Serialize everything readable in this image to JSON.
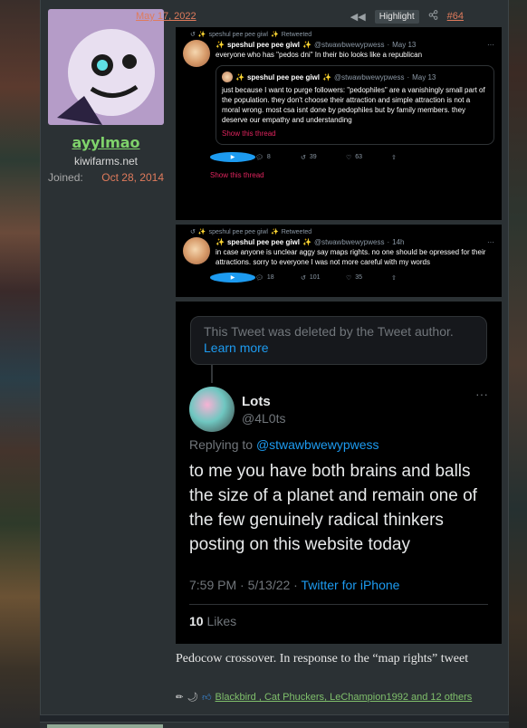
{
  "user": {
    "name": "ayylmao",
    "title": "kiwifarms.net",
    "joined_label": "Joined:",
    "joined_date": "Oct 28, 2014"
  },
  "post": {
    "date": "May 17, 2022",
    "highlight_label": "Highlight",
    "number": "#64",
    "caption": "Pedocow crossover. In response to the “map rights” tweet",
    "reactions_text": "Blackbird , Cat Phuckers, LeChampion1992 and 12 others"
  },
  "tweet1": {
    "retweeted_by": "speshul pee pee giwl",
    "retweeted_suffix": "Retweeted",
    "author_name": "speshul pee pee giwl",
    "author_handle": "@stwawbwewypwess",
    "date": "May 13",
    "text": "everyone who has \"pedos dni\" In their bio looks like a republican",
    "quote": {
      "author_name": "speshul pee pee giwl",
      "author_handle": "@stwawbwewypwess",
      "date": "May 13",
      "text": "just because I want to purge followers: \"pedophiles\" are a vanishingly small part of the population. they don't choose their attraction and simple attraction is not a moral wrong. most csa isnt done by pedophiles but by family members. they deserve our empathy and understanding",
      "show_thread": "Show this thread"
    },
    "replies": "8",
    "retweets": "39",
    "likes": "63",
    "show_thread": "Show this thread"
  },
  "tweet2": {
    "retweeted_by": "speshul pee pee giwl",
    "retweeted_suffix": "Retweeted",
    "author_name": "speshul pee pee giwl",
    "author_handle": "@stwawbwewypwess",
    "date": "14h",
    "text": "in case anyone is unclear aggy say maps rights. no one should be opressed for their attractions. sorry to everyone I was not more careful with my words",
    "replies": "18",
    "retweets": "101",
    "likes": "35"
  },
  "tweet3": {
    "deleted_text": "This Tweet was deleted by the Tweet author.",
    "learn_more": "Learn more",
    "author_name": "Lots",
    "author_handle": "@4L0ts",
    "replying_label": "Replying to",
    "replying_handle": "@stwawbwewypwess",
    "text": "to me you have both brains and balls the size of a planet and remain one of the few genuinely radical thinkers posting on this website today",
    "timestamp": "7:59 PM · 5/13/22 ·",
    "source": "Twitter for iPhone",
    "likes_count": "10",
    "likes_label": "Likes"
  }
}
